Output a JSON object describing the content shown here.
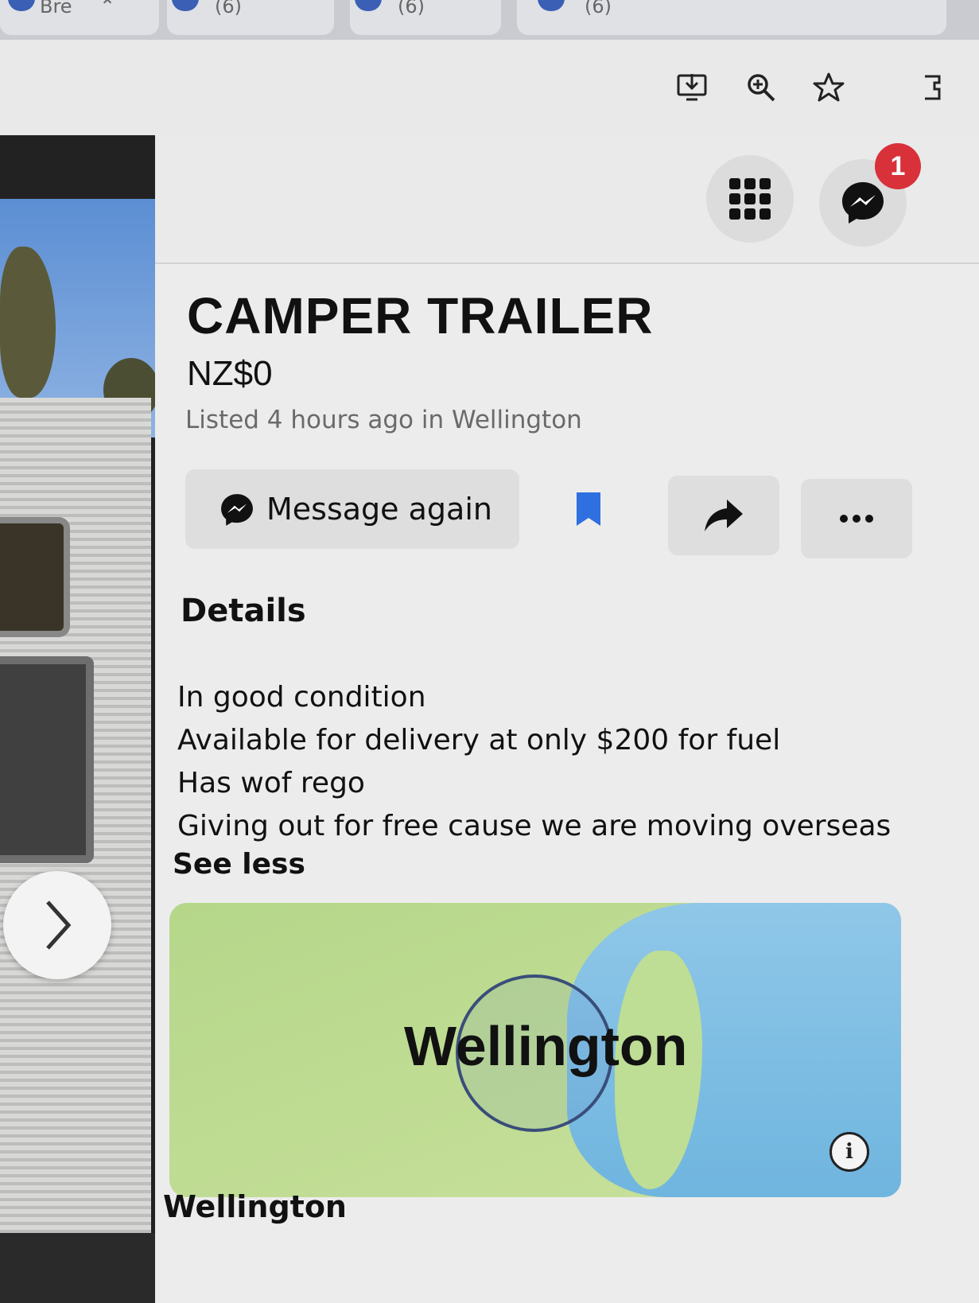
{
  "browser": {
    "tabs": [
      {
        "label": "Bre"
      },
      {
        "label": "(6)"
      },
      {
        "label": "(6)"
      },
      {
        "label": "(6)"
      }
    ]
  },
  "header": {
    "notification_count": "1"
  },
  "listing": {
    "title": "CAMPER TRAILER",
    "price": "NZ$0",
    "listed": "Listed 4 hours ago in Wellington",
    "message_label": "Message again",
    "details_heading": "Details",
    "description": [
      "In good condition",
      "Available for delivery at only $200 for fuel",
      "Has wof rego",
      "Giving out for free cause we are moving overseas"
    ],
    "see_less": "See less",
    "map_label": "Wellington",
    "location": "Wellington"
  },
  "colors": {
    "accent": "#1877f2",
    "badge": "#d8313a",
    "saved_icon": "#2f6fe0"
  },
  "icons": [
    "install-icon",
    "zoom-icon",
    "star-icon",
    "apps-grid-icon",
    "messenger-icon",
    "bookmark-icon",
    "share-icon",
    "more-icon",
    "chevron-right-icon",
    "info-icon"
  ]
}
